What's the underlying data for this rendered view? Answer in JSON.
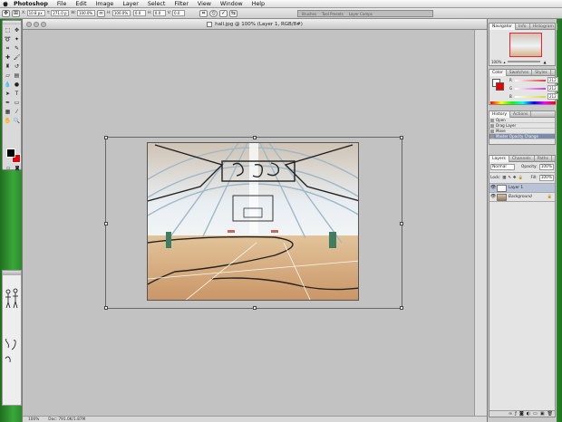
{
  "menubar": {
    "apple": "",
    "items": [
      "Photoshop",
      "File",
      "Edit",
      "Image",
      "Layer",
      "Select",
      "Filter",
      "View",
      "Window",
      "Help"
    ]
  },
  "options": {
    "fields": [
      {
        "label": "X:",
        "value": "10.8 px"
      },
      {
        "label": "Y:",
        "value": "271.0 px"
      },
      {
        "label": "W:",
        "value": "100.0%"
      },
      {
        "label": "H:",
        "value": "100.0%"
      },
      {
        "label": "",
        "value": "0.0"
      },
      {
        "label": "H:",
        "value": "0.0"
      },
      {
        "label": "V:",
        "value": "0.0"
      }
    ],
    "cancel_icon": "cancel-icon",
    "commit_icon": "commit-icon",
    "well_items": [
      "Brushes",
      "Tool Presets",
      "Layer Comps"
    ]
  },
  "document": {
    "title": "hall.jpg @ 100% (Layer 1, RGB/8#)",
    "zoom": "100%",
    "doc_info": "Doc: 791.0K/1.87M"
  },
  "navigator": {
    "tabs": [
      "Navigator",
      "Info",
      "Histogram"
    ],
    "zoom": "100%"
  },
  "color": {
    "tabs": [
      "Color",
      "Swatches",
      "Styles"
    ],
    "channels": [
      {
        "label": "R",
        "value": "212",
        "color": "#e23a3a"
      },
      {
        "label": "G",
        "value": "212",
        "color": "#3fb93f"
      },
      {
        "label": "B",
        "value": "212",
        "color": "#3a55e2"
      }
    ]
  },
  "history": {
    "tabs": [
      "History",
      "Actions"
    ],
    "items": [
      "Open",
      "Drag Layer",
      "Move",
      "Master Opacity Change"
    ]
  },
  "layers": {
    "tabs": [
      "Layers",
      "Channels",
      "Paths"
    ],
    "blend_mode": "Normal",
    "opacity_label": "Opacity:",
    "opacity": "100%",
    "lock_label": "Lock:",
    "fill_label": "Fill:",
    "fill": "100%",
    "items": [
      {
        "name": "Layer 1",
        "selected": true,
        "thumb": "#f7f7f7"
      },
      {
        "name": "Background",
        "selected": false,
        "thumb": "#9a7a55"
      }
    ]
  },
  "colors": {
    "foreground": "#000000",
    "background": "#e00000",
    "canvas_bg": "#c2c2c2",
    "desktop_green": "#2f8a2f"
  }
}
